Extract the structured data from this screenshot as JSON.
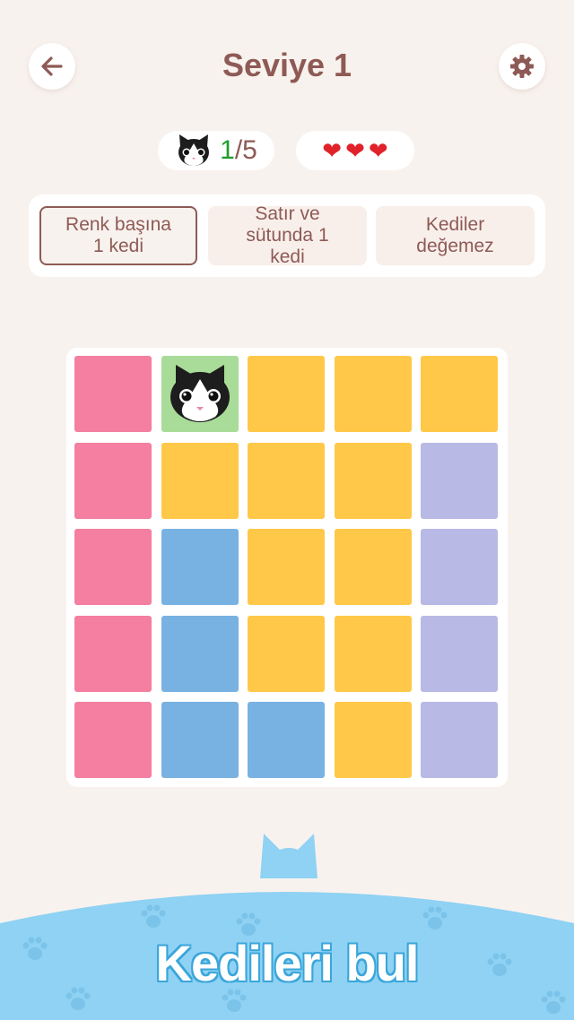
{
  "header": {
    "title": "Seviye 1",
    "back_icon": "arrow-left-icon",
    "settings_icon": "gear-icon"
  },
  "status": {
    "cats_found": "1",
    "cats_total": "/5",
    "lives": 3,
    "cat_icon": "cat-face-icon",
    "heart_icon": "heart-icon"
  },
  "rules": [
    {
      "label": "Renk başına 1 kedi",
      "selected": true
    },
    {
      "label": "Satır ve sütunda 1 kedi",
      "selected": false
    },
    {
      "label": "Kediler değemez",
      "selected": false
    }
  ],
  "colors": {
    "pink": "#f47fa0",
    "yellow": "#ffc848",
    "blue": "#78b2e2",
    "lavender": "#b9b9e6",
    "found": "#a8dc98"
  },
  "board": {
    "rows": [
      [
        "pink",
        "found",
        "yellow",
        "yellow",
        "yellow"
      ],
      [
        "pink",
        "yellow",
        "yellow",
        "yellow",
        "lavender"
      ],
      [
        "pink",
        "blue",
        "yellow",
        "yellow",
        "lavender"
      ],
      [
        "pink",
        "blue",
        "yellow",
        "yellow",
        "lavender"
      ],
      [
        "pink",
        "blue",
        "blue",
        "yellow",
        "lavender"
      ]
    ],
    "cat_cells": [
      [
        0,
        1
      ]
    ]
  },
  "footer": {
    "text": "Kedileri bul"
  }
}
